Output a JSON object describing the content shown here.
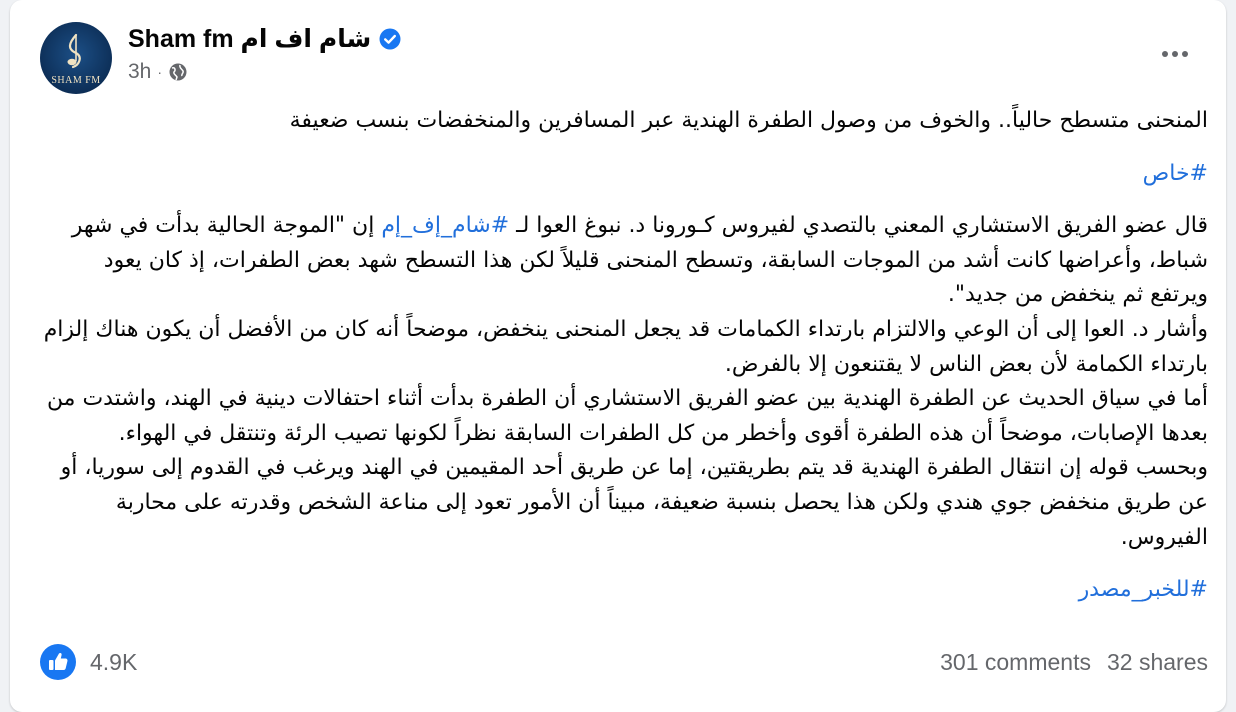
{
  "post": {
    "page_name": "Sham fm شام اف ام",
    "avatar_text": "SHAM FM",
    "time": "3h",
    "audience_icon": "globe-icon",
    "verified_icon": "verified-badge-icon",
    "more_icon": "more-options-icon",
    "headline": "المنحنى متسطح حالياً.. والخوف من وصول الطفرة الهندية عبر المسافرين والمنخفضات بنسب ضعيفة",
    "hashtag_top": "#خاص",
    "body": {
      "line1_prefix": "قال عضو الفريق الاستشاري المعني بالتصدي لفيروس كـورونا د. نبوغ العوا لـ ",
      "line1_hashtag": "#شام_إف_إم",
      "line1_suffix": " إن \"الموجة الحالية بدأت في شهر شباط، وأعراضها كانت أشد من الموجات السابقة، وتسطح المنحنى قليلاً لكن هذا التسطح شهد بعض الطفرات، إذ كان يعود ويرتفع ثم ينخفض من جديد\".",
      "p2": "وأشار د. العوا إلى أن الوعي والالتزام بارتداء الكمامات قد يجعل المنحنى ينخفض، موضحاً أنه كان من الأفضل أن يكون هناك إلزام بارتداء الكمامة لأن بعض الناس لا يقتنعون إلا بالفرض.",
      "p3": "أما في سياق الحديث عن الطفرة الهندية بين عضو الفريق الاستشاري أن الطفرة بدأت أثناء احتفالات دينية في الهند، واشتدت من بعدها الإصابات، موضحاً أن هذه الطفرة أقوى وأخطر من كل الطفرات السابقة نظراً لكونها تصيب الرئة وتنتقل في الهواء.",
      "p4": "وبحسب قوله إن انتقال الطفرة الهندية قد يتم بطريقتين، إما عن طريق أحد المقيمين في الهند ويرغب في القدوم إلى سوريا، أو عن طريق منخفض جوي هندي ولكن هذا يحصل بنسبة ضعيفة، مبيناً أن الأمور تعود إلى مناعة الشخص وقدرته على محاربة الفيروس."
    },
    "hashtag_bottom": "#للخبر_مصدر",
    "reactions": {
      "icon": "like-icon",
      "count": "4.9K"
    },
    "comments": "301 comments",
    "shares": "32 shares"
  },
  "colors": {
    "link": "#216fdb",
    "secondary_text": "#65676b",
    "like_blue": "#1877f2"
  }
}
